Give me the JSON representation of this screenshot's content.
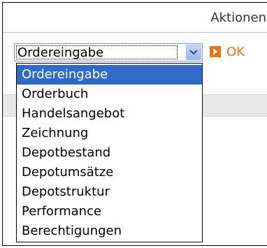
{
  "header": {
    "title": "Aktionen"
  },
  "select": {
    "value": "Ordereingabe",
    "options": [
      "Ordereingabe",
      "Orderbuch",
      "Handelsangebot",
      "Zeichnung",
      "Depotbestand",
      "Depotumsätze",
      "Depotstruktur",
      "Performance",
      "Berechtigungen"
    ],
    "selected_index": 0
  },
  "ok": {
    "label": "OK"
  },
  "icons": {
    "dropdown": "chevron-down-icon",
    "ok": "arrow-right-icon"
  },
  "colors": {
    "highlight": "#316ac5",
    "accent": "#e8761c"
  }
}
